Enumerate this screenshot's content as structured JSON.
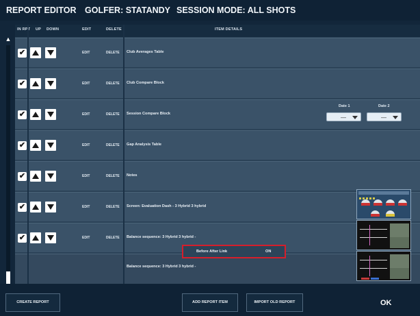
{
  "header": {
    "title": "REPORT EDITOR",
    "golfer": "GOLFER: STATANDY",
    "session_mode": "SESSION MODE: ALL SHOTS"
  },
  "columns": {
    "in_rpt": "IN RPT",
    "up": "UP",
    "down": "DOWN",
    "edit": "EDIT",
    "delete": "DELETE",
    "item_details": "ITEM DETAILS"
  },
  "rows": [
    {
      "checked": true,
      "edit": "EDIT",
      "delete": "DELETE",
      "label": "Club Averages Table"
    },
    {
      "checked": true,
      "edit": "EDIT",
      "delete": "DELETE",
      "label": "Club Compare Block"
    },
    {
      "checked": true,
      "edit": "EDIT",
      "delete": "DELETE",
      "label": "Session Compare Block"
    },
    {
      "checked": true,
      "edit": "EDIT",
      "delete": "DELETE",
      "label": "Gap Analysis Table"
    },
    {
      "checked": true,
      "edit": "EDIT",
      "delete": "DELETE",
      "label": "Notes"
    },
    {
      "checked": true,
      "edit": "EDIT",
      "delete": "DELETE",
      "label": "Screen: Evaluation Dash - 3 Hybrid 3 hybrid"
    },
    {
      "checked": true,
      "edit": "EDIT",
      "delete": "DELETE",
      "label": "Balance sequence: 3 Hybrid 3 hybrid -"
    }
  ],
  "session_compare": {
    "date1_label": "Date 1",
    "date1_value": "—",
    "date2_label": "Date 2",
    "date2_value": "—"
  },
  "before_after_link": {
    "label": "Before After Link",
    "value": "ON"
  },
  "extra_row_label": "Balance sequence: 3 Hybrid 3 hybrid -",
  "footer": {
    "create_report": "CREATE REPORT",
    "add_report_item": "ADD REPORT ITEM",
    "import_old_report": "IMPORT OLD REPORT",
    "ok": "OK"
  },
  "check_glyph": "✔",
  "scroll_up_glyph": "▲",
  "scroll_down_glyph": "▼",
  "colors": {
    "highlight_border": "#d61e2b",
    "background": "#12263a",
    "row": "#3a5268"
  }
}
